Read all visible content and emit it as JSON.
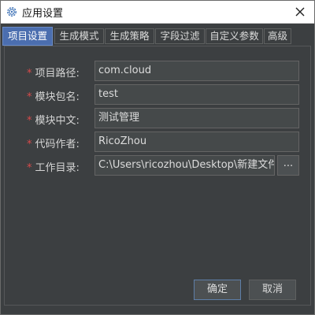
{
  "window": {
    "title": "应用设置"
  },
  "tabs": [
    {
      "label": "项目设置",
      "active": true
    },
    {
      "label": "生成模式"
    },
    {
      "label": "生成策略"
    },
    {
      "label": "字段过滤"
    },
    {
      "label": "自定义参数"
    },
    {
      "label": "高级"
    }
  ],
  "form": {
    "required_mark": "*",
    "fields": [
      {
        "label": "项目路径:",
        "value": "com.cloud"
      },
      {
        "label": "模块包名:",
        "value": "test"
      },
      {
        "label": "模块中文:",
        "value": "测试管理"
      },
      {
        "label": "代码作者:",
        "value": "RicoZhou"
      },
      {
        "label": "工作目录:",
        "value": "C:\\Users\\ricozhou\\Desktop\\新建文件夹"
      }
    ],
    "browse_label": "..."
  },
  "buttons": {
    "ok": "确定",
    "cancel": "取消"
  },
  "colors": {
    "accent": "#4b6eaf",
    "required": "#d94a4a",
    "background": "#3c3f41"
  },
  "icons": {
    "title": "gear-icon",
    "close": "close-icon"
  }
}
